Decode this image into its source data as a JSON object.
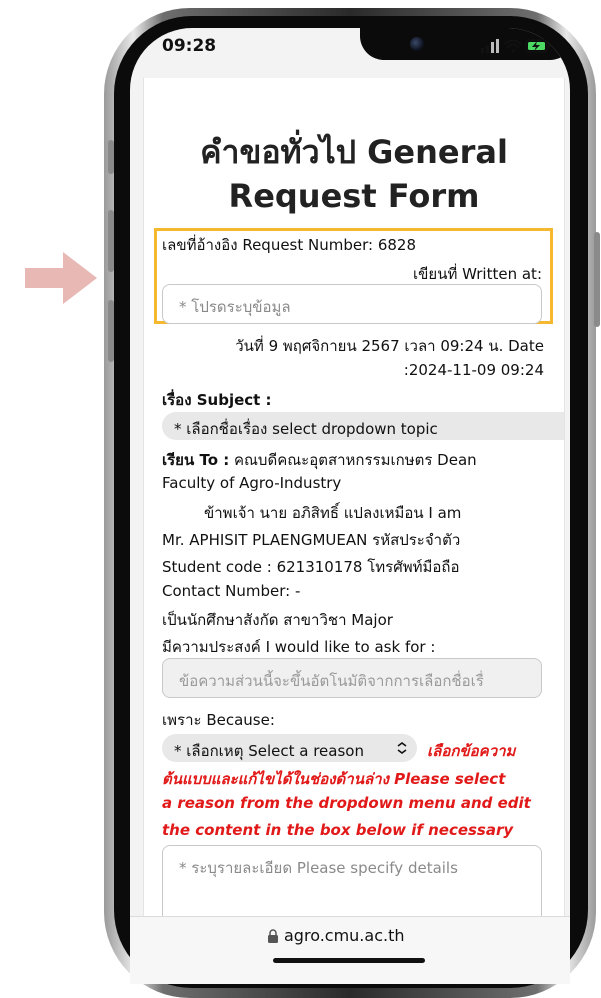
{
  "status_bar": {
    "time": "09:28"
  },
  "form": {
    "title_line1": "คำขอทั่วไป General",
    "title_line2": "Request Form",
    "request_number": "เลขที่อ้างอิง Request Number: 6828",
    "written_at_label": "เขียนที่ Written at:",
    "written_at_placeholder": "* โปรดระบุข้อมูล",
    "date_line1": "วันที่ 9 พฤศจิกายน 2567 เวลา 09:24 น. Date",
    "date_line2": ":2024-11-09 09:24",
    "subject_label": "เรื่อง Subject :",
    "subject_select": "* เลือกชื่อเรื่อง select dropdown topic",
    "to_label": "เรียน To :",
    "to_text1": " คณบดีคณะอุตสาหกรรมเกษตร Dean",
    "to_text2": "Faculty of Agro-Industry",
    "body_line1": "ข้าพเจ้า   นาย อภิสิทธิ์   แปลงเหมือน I am",
    "body_line2": "Mr. APHISIT   PLAENGMUEAN   รหัสประจำตัว",
    "body_line3": "Student code :   621310178   โทรศัพท์มือถือ",
    "body_line4": "Contact Number:   -",
    "body_line5": "เป็นนักศึกษาสังกัด สาขาวิชา Major",
    "body_line6": "มีความประสงค์ I would like to ask for :",
    "auto_field_placeholder": "ข้อความส่วนนี้จะขึ้นอัตโนมัติจากการเลือกชื่อเรื่",
    "because_label": "เพราะ Because:",
    "reason_select": "* เลือกเหตุ Select a reason",
    "hint_line1": "เลือกข้อความ",
    "hint_line2": "ต้นแบบและแก้ไขได้ในช่องด้านล่าง Please select",
    "hint_line3": "a reason from the dropdown menu and edit",
    "hint_line4": "the content in the box below if necessary",
    "details_placeholder": "* ระบุรายละเอียด Please specify details"
  },
  "browser": {
    "url": "agro.cmu.ac.th"
  },
  "colors": {
    "highlight": "#f5b82e",
    "hint": "#e11919",
    "arrow": "#e7b8b4"
  }
}
